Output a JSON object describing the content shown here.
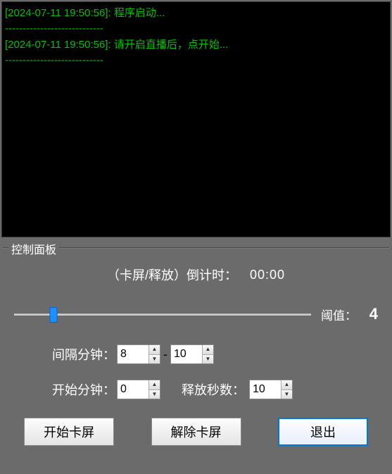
{
  "log": {
    "entries": [
      {
        "timestamp": "[2024-07-11 19:50:56]",
        "message": "程序启动..."
      },
      {
        "timestamp": "[2024-07-11 19:50:56]",
        "message": "请开启直播后，点开始..."
      }
    ],
    "separator": "----------------------------"
  },
  "panel": {
    "title": "控制面板",
    "countdown_label": "（卡屏/释放）倒计时：",
    "countdown_value": "00:00",
    "threshold_label": "阈值：",
    "threshold_value": "4",
    "slider": {
      "min": 0,
      "max": 30,
      "value": 4
    },
    "interval_label": "间隔分钟：",
    "interval_min": "8",
    "interval_max": "10",
    "start_label": "开始分钟：",
    "start_value": "0",
    "release_label": "释放秒数：",
    "release_value": "10",
    "buttons": {
      "start": "开始卡屏",
      "unfreeze": "解除卡屏",
      "exit": "退出"
    }
  }
}
